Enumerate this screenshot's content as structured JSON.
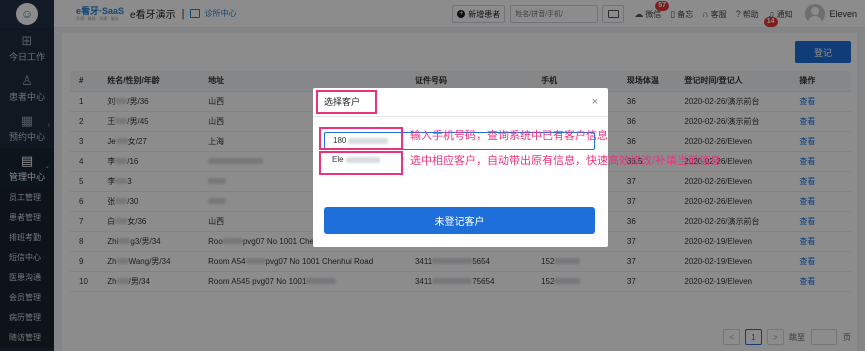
{
  "sidebar": {
    "logo_glyph": "☺",
    "main_items": [
      {
        "label": "今日工作",
        "icon": "grid-icon",
        "glyph": "⊞",
        "active": false
      },
      {
        "label": "患者中心",
        "icon": "user-icon",
        "glyph": "♙",
        "active": false
      },
      {
        "label": "预约中心",
        "icon": "calendar-icon",
        "glyph": "▦",
        "active": false
      },
      {
        "label": "管理中心",
        "icon": "book-icon",
        "glyph": "▤",
        "active": true
      }
    ],
    "sub_items": [
      "员工管理",
      "患者管理",
      "排班考勤",
      "短信中心",
      "医患沟通",
      "会员管理",
      "病历管理",
      "随访管理"
    ]
  },
  "topbar": {
    "brand_logo": "e看牙·SaaS",
    "brand_sub": "开通 · 建档 · 沟通 · 服务",
    "brand_name": "e看牙演示",
    "separator": "|",
    "clinic": "诊所中心",
    "new_patient": "新增患者",
    "search_placeholder": "姓名/拼音/手机/",
    "wechat": "微信",
    "wechat_badge": "57",
    "memo": "备忘",
    "service": "客服",
    "help": "帮助",
    "notice": "通知",
    "notice_badge": "14",
    "user": "Eleven"
  },
  "content": {
    "register_label": "登记",
    "columns": [
      "#",
      "姓名/性别/年龄",
      "地址",
      "证件号码",
      "手机",
      "现场体温",
      "登记时间/登记人",
      "操作"
    ],
    "rows": [
      {
        "no": "1",
        "name": "刘",
        "name_tail": "/男/36",
        "address": "山西",
        "id": "",
        "phone": "",
        "temp": "36",
        "reg": "2020-02-26/演示前台",
        "op": "查看"
      },
      {
        "no": "2",
        "name": "王",
        "name_tail": "/男/45",
        "address": "山西",
        "id": "",
        "phone": "",
        "temp": "36",
        "reg": "2020-02-26/演示前台",
        "op": "查看"
      },
      {
        "no": "3",
        "name": "Je",
        "name_tail": "女/27",
        "address": "上海",
        "id": "",
        "phone": "",
        "temp": "36",
        "reg": "2020-02-26/Eleven",
        "op": "查看"
      },
      {
        "no": "4",
        "name": "李",
        "name_tail": "/16",
        "address": "",
        "id": "",
        "phone": "",
        "temp": "36.5",
        "reg": "2020-02-26/Eleven",
        "op": "查看"
      },
      {
        "no": "5",
        "name": "李",
        "name_tail": "3",
        "address": "",
        "id": "",
        "phone": "",
        "temp": "37",
        "reg": "2020-02-26/Eleven",
        "op": "查看"
      },
      {
        "no": "6",
        "name": "张",
        "name_tail": "/30",
        "address": "",
        "id": "",
        "phone": "",
        "temp": "37",
        "reg": "2020-02-26/Eleven",
        "op": "查看"
      },
      {
        "no": "7",
        "name": "白",
        "name_tail": "女/36",
        "address": "山西",
        "id": "",
        "phone": "",
        "temp": "36",
        "reg": "2020-02-26/演示前台",
        "op": "查看"
      },
      {
        "no": "8",
        "name": "Zhi",
        "name_tail": "g3/男/34",
        "address": "Roo",
        "address_tail": "pvg07 No 1001 Chenhui Road",
        "id": "6226",
        "id_tail": "1563",
        "phone": "15",
        "phone_tail": "71",
        "temp": "37",
        "reg": "2020-02-19/Eleven",
        "op": "查看"
      },
      {
        "no": "9",
        "name": "Zh",
        "name_tail": "Wang/男/34",
        "address": "Room A54",
        "address_tail": "pvg07 No 1001 Chenhui Road",
        "id": "3411",
        "id_tail": "5654",
        "phone": "152",
        "phone_tail": "",
        "temp": "37",
        "reg": "2020-02-19/Eleven",
        "op": "查看"
      },
      {
        "no": "10",
        "name": "Zh",
        "name_tail": "/男/34",
        "address": "Room A545 pvg07 No 1001",
        "address_tail": "",
        "id": "3411",
        "id_tail": "75654",
        "phone": "152",
        "phone_tail": "",
        "temp": "37",
        "reg": "2020-02-19/Eleven",
        "op": "查看"
      }
    ],
    "pager": {
      "prev": "<",
      "current": "1",
      "next": ">",
      "jump_label": "跳至",
      "page_label": "页"
    }
  },
  "modal": {
    "title": "选择客户",
    "close": "×",
    "phone_value": "180",
    "option_value": "Ele",
    "button": "未登记客户"
  },
  "annotations": {
    "note1": "输入手机号码，查询系统中已有客户信息",
    "note2": "选中相应客户，自动带出原有信息，快速高效修改/补填当前信息"
  },
  "colors": {
    "accent": "#1e6fd9",
    "annotation": "#e8347c",
    "sidebar": "#1f2d3d"
  }
}
